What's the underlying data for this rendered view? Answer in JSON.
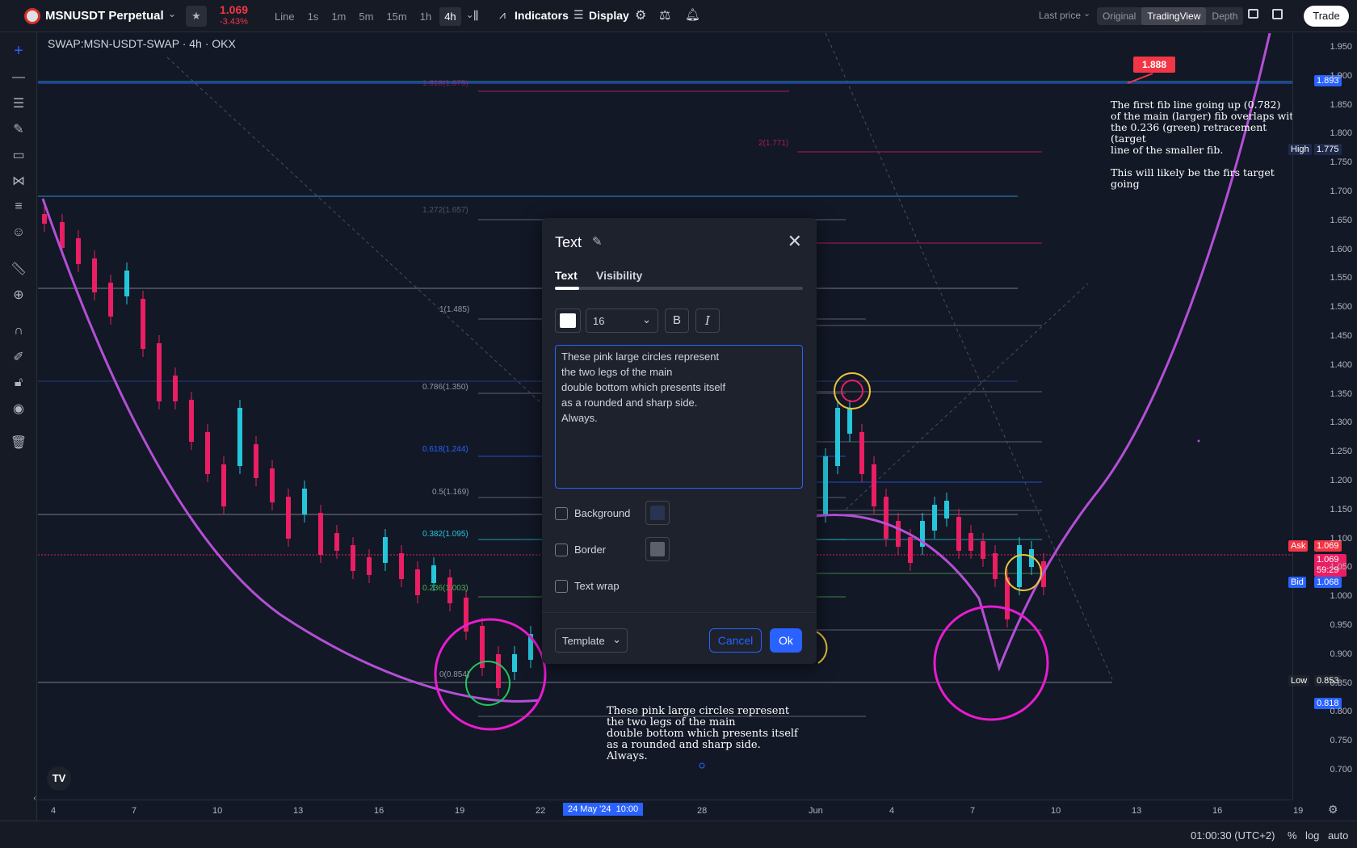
{
  "header": {
    "symbol": "MSNUSDT Perpetual",
    "price": "1.069",
    "change": "-3.43%",
    "timeframes": [
      "Line",
      "1s",
      "1m",
      "5m",
      "15m",
      "1h",
      "4h"
    ],
    "active_timeframe": "4h",
    "indicators_label": "Indicators",
    "display_label": "Display",
    "last_price_label": "Last price",
    "views": [
      "Original",
      "TradingView",
      "Depth"
    ],
    "active_view": "TradingView",
    "trade_label": "Trade"
  },
  "chart": {
    "legend": "SWAP:MSN-USDT-SWAP · 4h · OKX",
    "price_ticks": [
      "1.950",
      "1.900",
      "1.850",
      "1.800",
      "1.750",
      "1.700",
      "1.650",
      "1.600",
      "1.550",
      "1.500",
      "1.450",
      "1.400",
      "1.350",
      "1.300",
      "1.250",
      "1.200",
      "1.150",
      "1.100",
      "1.050",
      "1.000",
      "0.950",
      "0.900",
      "0.850",
      "0.800",
      "0.750",
      "0.700"
    ],
    "time_ticks": [
      "4",
      "7",
      "10",
      "13",
      "16",
      "19",
      "22",
      "28",
      "Jun",
      "4",
      "7",
      "10",
      "13",
      "16",
      "19"
    ],
    "cursor_time_date": "24 May '24",
    "cursor_time_clock": "10:00",
    "price_tags": {
      "top": "1.893",
      "high_label": "High",
      "high": "1.775",
      "ask_label": "Ask",
      "ask": "1.069",
      "last": "1.069",
      "countdown": "59:29",
      "bid_label": "Bid",
      "bid": "1.068",
      "low_label": "Low",
      "low": "0.853",
      "bottom": "0.818"
    },
    "callout": "1.888",
    "fib_levels": [
      "1.618(1.875)",
      "1.272(1.657)",
      "1(1.485)",
      "0.786(1.350)",
      "0.618(1.244)",
      "0.5(1.169)",
      "0.382(1.095)",
      "0.236(1.003)",
      "0(0.854)",
      "2(1.771)"
    ],
    "note_right": [
      "The first fib line going up (0.782)",
      "of the main (larger) fib overlaps with",
      "the 0.236 (green) retracement (target",
      "line of the smaller fib.",
      "",
      "This will likely be the firs target going"
    ],
    "note_bottom": [
      "These pink large circles represent",
      "the two legs of the main",
      "double bottom which presents itself",
      "as a rounded and sharp side.",
      "Always."
    ]
  },
  "dialog": {
    "title": "Text",
    "tabs": [
      "Text",
      "Visibility"
    ],
    "active_tab": "Text",
    "font_size": "16",
    "bold_label": "B",
    "italic_label": "I",
    "text_value": "These pink large circles represent\nthe two legs of the main\ndouble bottom which presents itself\nas a rounded and sharp side.\nAlways.",
    "background_label": "Background",
    "border_label": "Border",
    "text_wrap_label": "Text wrap",
    "template_label": "Template",
    "cancel_label": "Cancel",
    "ok_label": "Ok"
  },
  "footer": {
    "clock": "01:00:30 (UTC+2)",
    "percent_label": "%",
    "log_label": "log",
    "auto_label": "auto"
  },
  "colors": {
    "background": "#121826",
    "up": "#26c6da",
    "down": "#e91e63",
    "accent": "#2962ff",
    "circle_pink": "#e81cd0",
    "curve_purple": "#b44fd6"
  }
}
